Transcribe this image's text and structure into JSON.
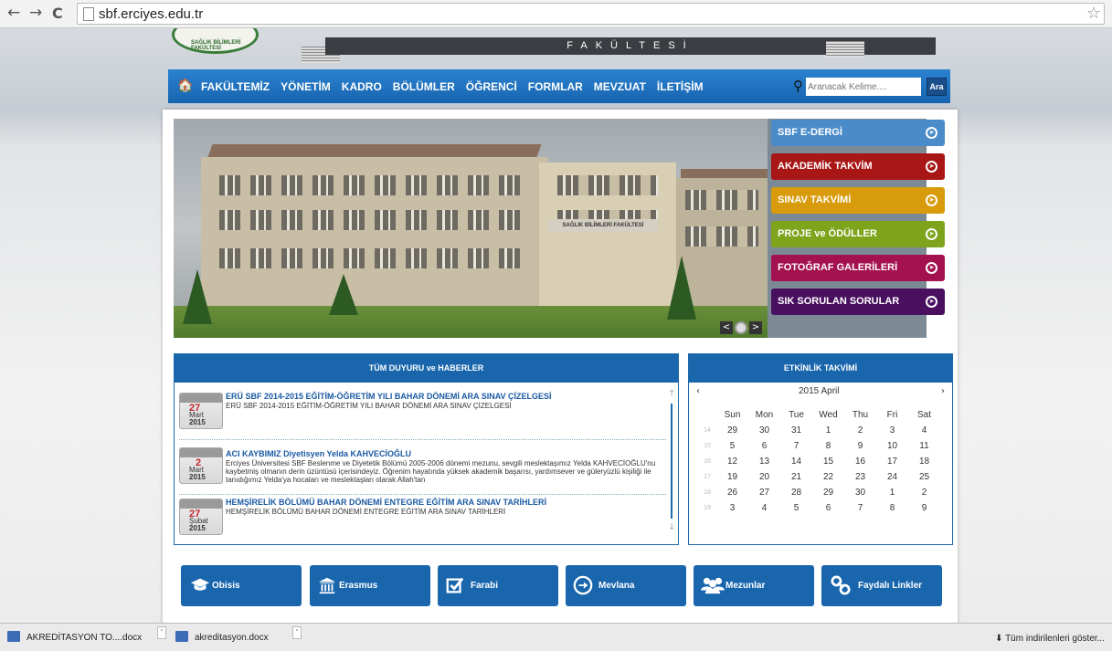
{
  "browser": {
    "back_glyph": "←",
    "forward_glyph": "→",
    "reload_glyph": "C",
    "url": "sbf.erciyes.edu.tr",
    "star_glyph": "☆"
  },
  "header": {
    "logo_text": "SAĞLIK BİLİMLERİ FAKÜLTESİ",
    "band_text": "FAKÜLTESİ"
  },
  "menu": {
    "home_glyph": "🏠",
    "items": [
      "FAKÜLTEMİZ",
      "YÖNETİM",
      "KADRO",
      "BÖLÜMLER",
      "ÖĞRENCİ",
      "FORMLAR",
      "MEVZUAT",
      "İLETİŞİM"
    ],
    "search_placeholder": "Aranacak Kelime....",
    "search_button": "Ara"
  },
  "slider": {
    "sign_text": "SAĞLIK BİLİMLERİ FAKÜLTESİ",
    "prev_glyph": "<",
    "next_glyph": ">"
  },
  "quick_links": [
    {
      "label": "SBF E-DERGİ",
      "color": "#4a8bc9"
    },
    {
      "label": "AKADEMİK TAKVİM",
      "color": "#a81616"
    },
    {
      "label": "SINAV TAKVİMİ",
      "color": "#d79b0c"
    },
    {
      "label": "PROJE ve ÖDÜLLER",
      "color": "#7ea41c"
    },
    {
      "label": "FOTOĞRAF GALERİLERİ",
      "color": "#a3114e"
    },
    {
      "label": "SIK SORULAN SORULAR",
      "color": "#4a1060"
    }
  ],
  "news": {
    "title": "TÜM DUYURU ve HABERLER",
    "items": [
      {
        "day": "27",
        "month": "Mart",
        "year": "2015",
        "title": "ERÜ SBF 2014-2015 EĞİTİM-ÖĞRETİM YILI BAHAR DÖNEMİ ARA SINAV ÇİZELGESİ",
        "desc": "ERÜ SBF 2014-2015 EĞİTİM-ÖĞRETİM YILI BAHAR DÖNEMİ ARA SINAV ÇİZELGESİ"
      },
      {
        "day": "2",
        "month": "Mart",
        "year": "2015",
        "title": "ACI KAYBIMIZ Diyetisyen Yelda KAHVECİOĞLU",
        "desc": "Erciyes Üniversitesi SBF Beslenme ve Diyetetik Bölümü 2005-2006 dönemi mezunu, sevgili meslektaşımız Yelda KAHVECİOĞLU'nu kaybetmiş olmanın derin üzüntüsü içerisindeyiz. Öğrenim hayatında yüksek akademik başarısı, yardımsever ve güleryüzlü kişiliği ile tanıdığımız Yelda'ya hocaları ve meslektaşları olarak Allah'tan"
      },
      {
        "day": "27",
        "month": "Şubat",
        "year": "2015",
        "title": "HEMŞİRELİK BÖLÜMÜ BAHAR DÖNEMİ ENTEGRE EĞİTİM ARA SINAV TARİHLERİ",
        "desc": "HEMŞİRELİK BÖLÜMÜ BAHAR DÖNEMİ ENTEGRE EĞİTİM ARA SINAV TARİHLERİ"
      }
    ],
    "scroll_up": "↑",
    "scroll_down": "↓"
  },
  "events": {
    "title": "ETKİNLİK TAKVİMİ",
    "prev": "‹",
    "next": "›",
    "month_label": "2015 April",
    "weekdays": [
      "Sun",
      "Mon",
      "Tue",
      "Wed",
      "Thu",
      "Fri",
      "Sat"
    ],
    "weeks": [
      {
        "wk": "14",
        "days": [
          "29",
          "30",
          "31",
          "1",
          "2",
          "3",
          "4"
        ]
      },
      {
        "wk": "15",
        "days": [
          "5",
          "6",
          "7",
          "8",
          "9",
          "10",
          "11"
        ]
      },
      {
        "wk": "16",
        "days": [
          "12",
          "13",
          "14",
          "15",
          "16",
          "17",
          "18"
        ]
      },
      {
        "wk": "17",
        "days": [
          "19",
          "20",
          "21",
          "22",
          "23",
          "24",
          "25"
        ]
      },
      {
        "wk": "18",
        "days": [
          "26",
          "27",
          "28",
          "29",
          "30",
          "1",
          "2"
        ]
      },
      {
        "wk": "19",
        "days": [
          "3",
          "4",
          "5",
          "6",
          "7",
          "8",
          "9"
        ]
      }
    ]
  },
  "bottom_buttons": [
    {
      "label": "Obisis",
      "icon": "graduation-cap-icon"
    },
    {
      "label": "Erasmus",
      "icon": "institution-icon"
    },
    {
      "label": "Farabi",
      "icon": "check-square-icon"
    },
    {
      "label": "Mevlana",
      "icon": "arrow-circle-icon"
    },
    {
      "label": "Mezunlar",
      "icon": "users-icon"
    },
    {
      "label": "Faydalı Linkler",
      "icon": "link-icon"
    }
  ],
  "downloads": {
    "items": [
      "AKREDİTASYON TO....docx",
      "akreditasyon.docx"
    ],
    "show_all": "Tüm indirilenleri göster..."
  }
}
